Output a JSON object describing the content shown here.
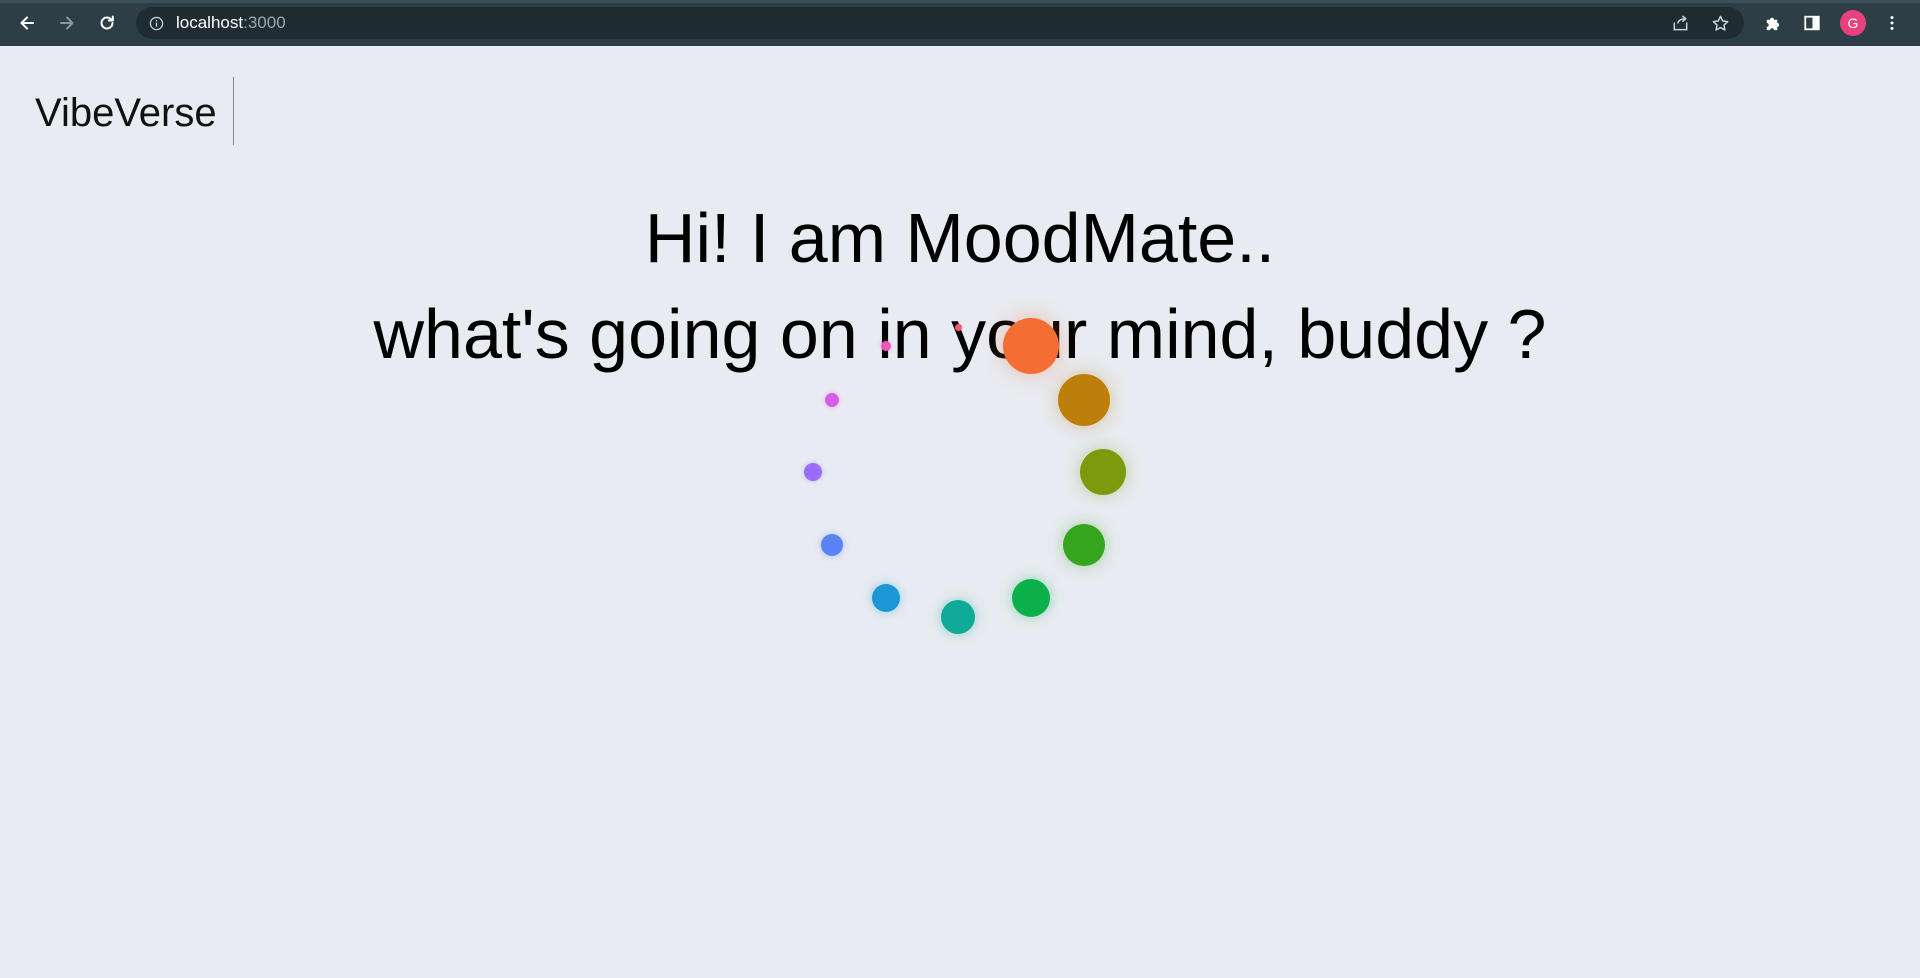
{
  "browser": {
    "url_host": "localhost",
    "url_port": ":3000",
    "profile_initial": "G",
    "icons": [
      "back-arrow-icon",
      "forward-arrow-icon",
      "reload-icon",
      "info-icon",
      "share-icon",
      "star-icon",
      "extensions-puzzle-icon",
      "side-panel-icon",
      "menu-kebab-icon"
    ]
  },
  "header": {
    "brand": "VibeVerse"
  },
  "main": {
    "greeting_line1": "Hi! I am MoodMate..",
    "greeting_line2": "what's going on in your mind, buddy ?"
  },
  "spinner": {
    "dot_colors": [
      "#f46d32",
      "#bd7f0a",
      "#7c9a0e",
      "#34a51d",
      "#0bb04a",
      "#10ab98",
      "#1b96d6",
      "#5983f5",
      "#9b6cf7",
      "#d35ee6",
      "#ee57b9",
      "#f2587b"
    ]
  }
}
